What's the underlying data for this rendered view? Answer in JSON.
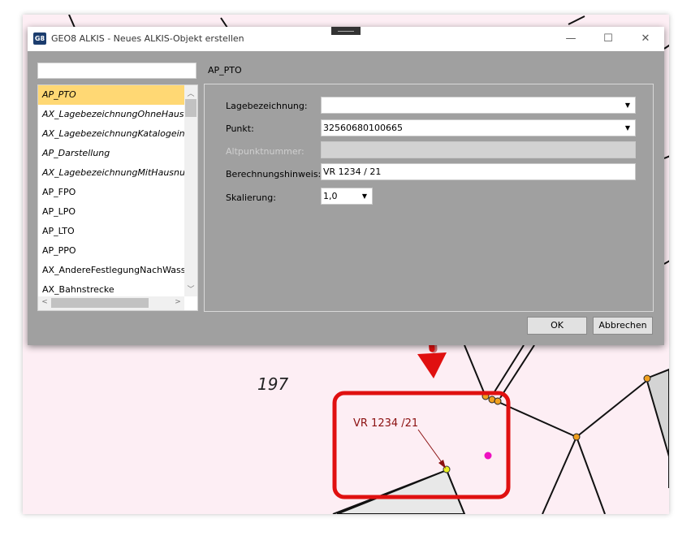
{
  "map": {
    "parcel_number": "197",
    "annotation_label": "VR 1234 /21"
  },
  "window": {
    "app_icon": "G8",
    "title": "GEO8 ALKIS - Neues ALKIS-Objekt erstellen",
    "controls": {
      "minimize": "—",
      "maximize": "☐",
      "close": "✕"
    }
  },
  "search": {
    "value": ""
  },
  "breadcrumb": "AP_PTO",
  "object_list": {
    "items": [
      {
        "label": "AP_PTO",
        "italic": true,
        "selected": true
      },
      {
        "label": "AX_LagebezeichnungOhneHausnummer",
        "italic": true
      },
      {
        "label": "AX_LagebezeichnungKatalogeintrag",
        "italic": true
      },
      {
        "label": "AP_Darstellung",
        "italic": true
      },
      {
        "label": "AX_LagebezeichnungMitHausnummer",
        "italic": true
      },
      {
        "label": "AP_FPO",
        "italic": false
      },
      {
        "label": "AP_LPO",
        "italic": false
      },
      {
        "label": "AP_LTO",
        "italic": false
      },
      {
        "label": "AP_PPO",
        "italic": false
      },
      {
        "label": "AX_AndereFestlegungNachWasserrecht",
        "italic": false
      },
      {
        "label": "AX_Bahnstrecke",
        "italic": false
      }
    ]
  },
  "form": {
    "lagebezeichnung": {
      "label": "Lagebezeichnung:",
      "value": ""
    },
    "punkt": {
      "label": "Punkt:",
      "value": "32560680100665"
    },
    "altpunktnummer": {
      "label": "Altpunktnummer:",
      "value": ""
    },
    "berechnungshinweis": {
      "label": "Berechnungshinweis:",
      "value": "VR 1234 / 21"
    },
    "skalierung": {
      "label": "Skalierung:",
      "value": "1,0"
    }
  },
  "buttons": {
    "ok": "OK",
    "cancel": "Abbrechen"
  },
  "colors": {
    "map_background": "#fdeef4",
    "highlight_red": "#e01010",
    "selection": "#ffd874",
    "dialog_gray": "#a0a0a0"
  }
}
